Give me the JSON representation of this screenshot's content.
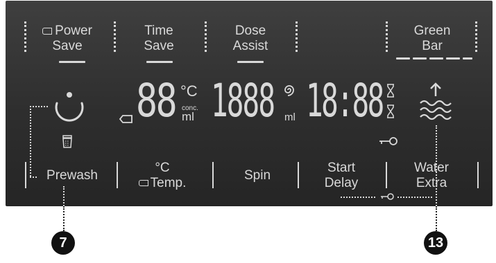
{
  "top_options": [
    {
      "line1": "Power",
      "line2": "Save",
      "icon": "hand-symbol-icon"
    },
    {
      "line1": "Time",
      "line2": "Save"
    },
    {
      "line1": "Dose",
      "line2": "Assist"
    },
    {
      "line1": "Green",
      "line2": "Bar"
    }
  ],
  "display": {
    "temp_digits": "88",
    "temp_unit": "°C",
    "conc_label": "conc.",
    "conc_unit": "ml",
    "spin_digits": "1888",
    "dose_unit": "ml",
    "time_digits": "18:88"
  },
  "buttons": [
    {
      "label": "Prewash"
    },
    {
      "line1": "°C",
      "line2": "Temp."
    },
    {
      "label": "Spin"
    },
    {
      "line1": "Start",
      "line2": "Delay"
    },
    {
      "line1": "Water",
      "line2": "Extra"
    }
  ],
  "callouts": {
    "left": "7",
    "right": "13"
  },
  "colors": {
    "panel": "#333333",
    "segment": "#d9d9d9",
    "callout": "#111111"
  }
}
